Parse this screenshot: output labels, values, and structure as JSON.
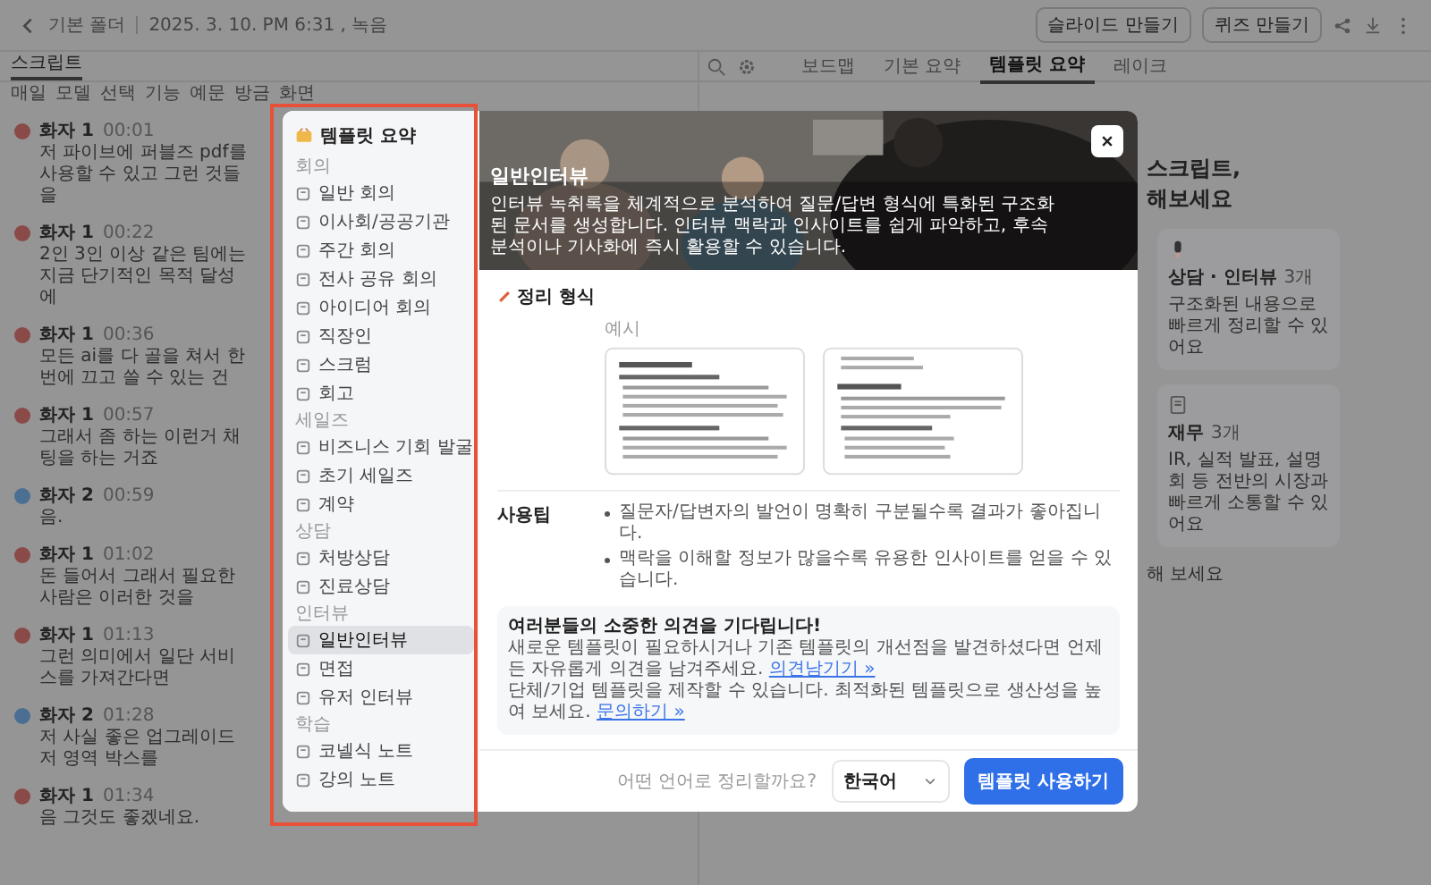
{
  "topbar": {
    "breadcrumb": "기본 폴더",
    "recorded": "2025. 3. 10. PM 6:31 , 녹음",
    "buttons": [
      {
        "label": "슬라이드 만들기"
      },
      {
        "label": "퀴즈 만들기"
      }
    ]
  },
  "script_panel": {
    "tab": "스크립트",
    "keywords": [
      "매일",
      "모델",
      "선택",
      "기능",
      "예문",
      "방금",
      "화면"
    ],
    "entries": [
      {
        "speaker": "화자 1",
        "time": "00:01",
        "color": "#8a4a48",
        "text": "저 파이브에 퍼블즈 pdf를 사용할 수 있고 그런 것들을"
      },
      {
        "speaker": "화자 1",
        "time": "00:22",
        "color": "#8a4a48",
        "text": "2인 3인 이상 같은 팀에는 지금 단기적인 목적 달성에"
      },
      {
        "speaker": "화자 1",
        "time": "00:36",
        "color": "#8a4a48",
        "text": "모든 ai를 다 골을 쳐서 한 번에 끄고 쓸 수 있는 건"
      },
      {
        "speaker": "화자 1",
        "time": "00:57",
        "color": "#8a4a48",
        "text": "그래서 좀 하는 이런거 채팅을 하는 거죠"
      },
      {
        "speaker": "화자 2",
        "time": "00:59",
        "color": "#4a6f92",
        "text": "음."
      },
      {
        "speaker": "화자 1",
        "time": "01:02",
        "color": "#8a4a48",
        "text": "돈 들어서 그래서 필요한 사람은 이러한 것을"
      },
      {
        "speaker": "화자 1",
        "time": "01:13",
        "color": "#8a4a48",
        "text": "그런 의미에서 일단 서비스를 가져간다면"
      },
      {
        "speaker": "화자 2",
        "time": "01:28",
        "color": "#4a6f92",
        "text": "저 사실 좋은 업그레이드 저 영역 박스를"
      },
      {
        "speaker": "화자 1",
        "time": "01:34",
        "color": "#8a4a48",
        "text": "음 그것도 좋겠네요."
      }
    ]
  },
  "view_tabs": [
    {
      "label": "보드맵",
      "selected": false
    },
    {
      "label": "기본 요약",
      "selected": false
    },
    {
      "label": "템플릿 요약",
      "selected": true
    },
    {
      "label": "레이크",
      "selected": false
    }
  ],
  "right_panel": {
    "heading": [
      "스크립트,",
      "해보세요"
    ],
    "cards": [
      {
        "title": "상담 · 인터뷰",
        "count": "3개",
        "text": "구조화된 내용으로 빠르게 정리할 수 있어요"
      },
      {
        "title": "재무",
        "count": "3개",
        "text": "IR, 실적 발표, 설명회 등 전반의 시장과 빠르게 소통할 수 있어요"
      }
    ],
    "more": "해 보세요"
  },
  "modal": {
    "sidebar": {
      "title": "템플릿 요약",
      "sections": [
        {
          "title": "회의",
          "items": [
            {
              "label": "일반 회의",
              "selected": false
            },
            {
              "label": "이사회/공공기관",
              "selected": false
            },
            {
              "label": "주간 회의",
              "selected": false
            },
            {
              "label": "전사 공유 회의",
              "selected": false
            },
            {
              "label": "아이디어 회의",
              "selected": false
            },
            {
              "label": "직장인",
              "selected": false
            },
            {
              "label": "스크럼",
              "selected": false
            },
            {
              "label": "회고",
              "selected": false
            }
          ]
        },
        {
          "title": "세일즈",
          "items": [
            {
              "label": "비즈니스 기회 발굴",
              "selected": false
            },
            {
              "label": "초기 세일즈",
              "selected": false
            },
            {
              "label": "계약",
              "selected": false
            }
          ]
        },
        {
          "title": "상담",
          "items": [
            {
              "label": "처방상담",
              "selected": false
            },
            {
              "label": "진료상담",
              "selected": false
            }
          ]
        },
        {
          "title": "인터뷰",
          "items": [
            {
              "label": "일반인터뷰",
              "selected": true
            },
            {
              "label": "면접",
              "selected": false
            },
            {
              "label": "유저 인터뷰",
              "selected": false
            }
          ]
        },
        {
          "title": "학습",
          "items": [
            {
              "label": "코넬식 노트",
              "selected": false
            },
            {
              "label": "강의 노트",
              "selected": false
            }
          ]
        }
      ]
    },
    "header": {
      "title": "일반인터뷰",
      "description": "인터뷰 녹취록을 체계적으로 분석하여 질문/답변 형식에 특화된 구조화된 문서를 생성합니다. 인터뷰 맥락과 인사이트를 쉽게 파악하고, 후속 분석이나 기사화에 즉시 활용할 수 있습니다."
    },
    "format": {
      "title": "정리 형식",
      "example_label": "예시"
    },
    "tips": {
      "title": "사용팁",
      "items": [
        "질문자/답변자의 발언이 명확히 구분될수록 결과가 좋아집니다.",
        "맥락을 이해할 정보가 많을수록 유용한 인사이트를 얻을 수 있습니다."
      ]
    },
    "feedback": {
      "title": "여러분들의 소중한 의견을 기다립니다!",
      "lines": [
        {
          "text": "새로운 템플릿이 필요하시거나 기존 템플릿의 개선점을 발견하셨다면 언제든 자유롭게 의견을 남겨주세요.",
          "link": "의견남기기 »"
        },
        {
          "text": "단체/기업 템플릿을 제작할 수 있습니다. 최적화된 템플릿으로 생산성을 높여 보세요.",
          "link": "문의하기 »"
        }
      ]
    },
    "footer": {
      "language_prompt": "어떤 언어로 정리할까요?",
      "language": "한국어",
      "submit": "템플릿 사용하기"
    }
  }
}
